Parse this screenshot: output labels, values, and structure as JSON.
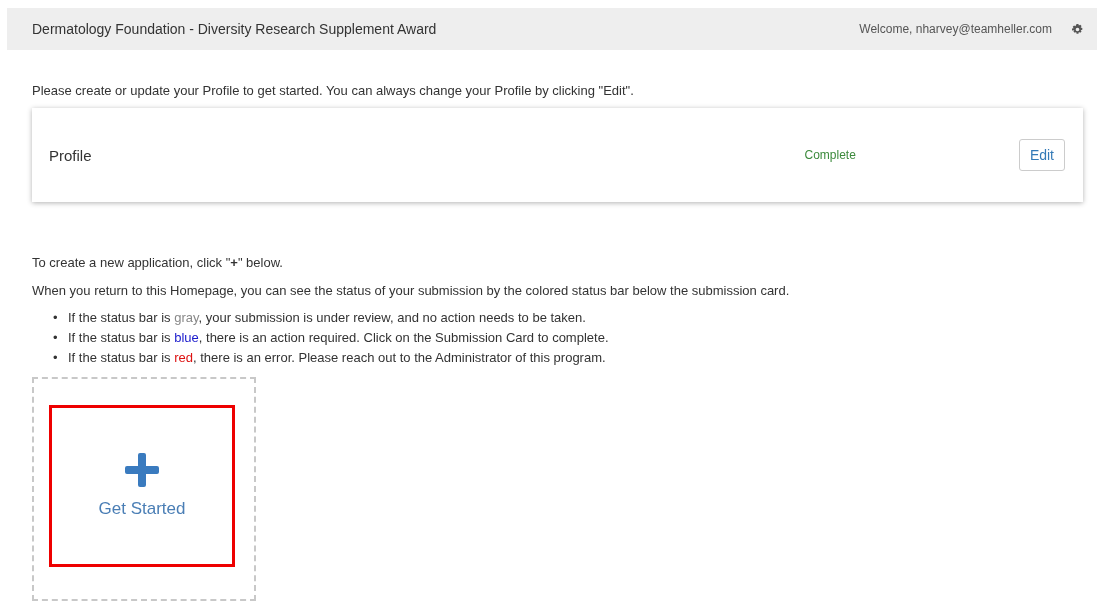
{
  "header": {
    "title": "Dermatology Foundation - Diversity Research Supplement Award",
    "welcome": "Welcome, nharvey@teamheller.com"
  },
  "intro": "Please create or update your Profile to get started. You can always change your Profile by clicking \"Edit\".",
  "profile": {
    "label": "Profile",
    "status": "Complete",
    "edit_button": "Edit"
  },
  "instructions": [
    "To create a new application, click \"**+**\" below.",
    "When you return to this Homepage, you can see the status of your submission by the colored status bar below the submission card."
  ],
  "status_legend": [
    {
      "bullet": "•",
      "before": "If the status bar is ",
      "word": "gray",
      "after": ", your submission is under review, and no action needs to be taken.",
      "color": "#888888"
    },
    {
      "bullet": "•",
      "before": "If the status bar is ",
      "word": "blue",
      "after": ", there is an action required. Click on the Submission Card to complete.",
      "color": "#1a1acc"
    },
    {
      "bullet": "•",
      "before": "If the status bar is ",
      "word": "red",
      "after": ", there is an error. Please reach out to the Administrator of this program.",
      "color": "#dd1111"
    }
  ],
  "new_card": {
    "label": "Get Started",
    "highlighted": true
  }
}
